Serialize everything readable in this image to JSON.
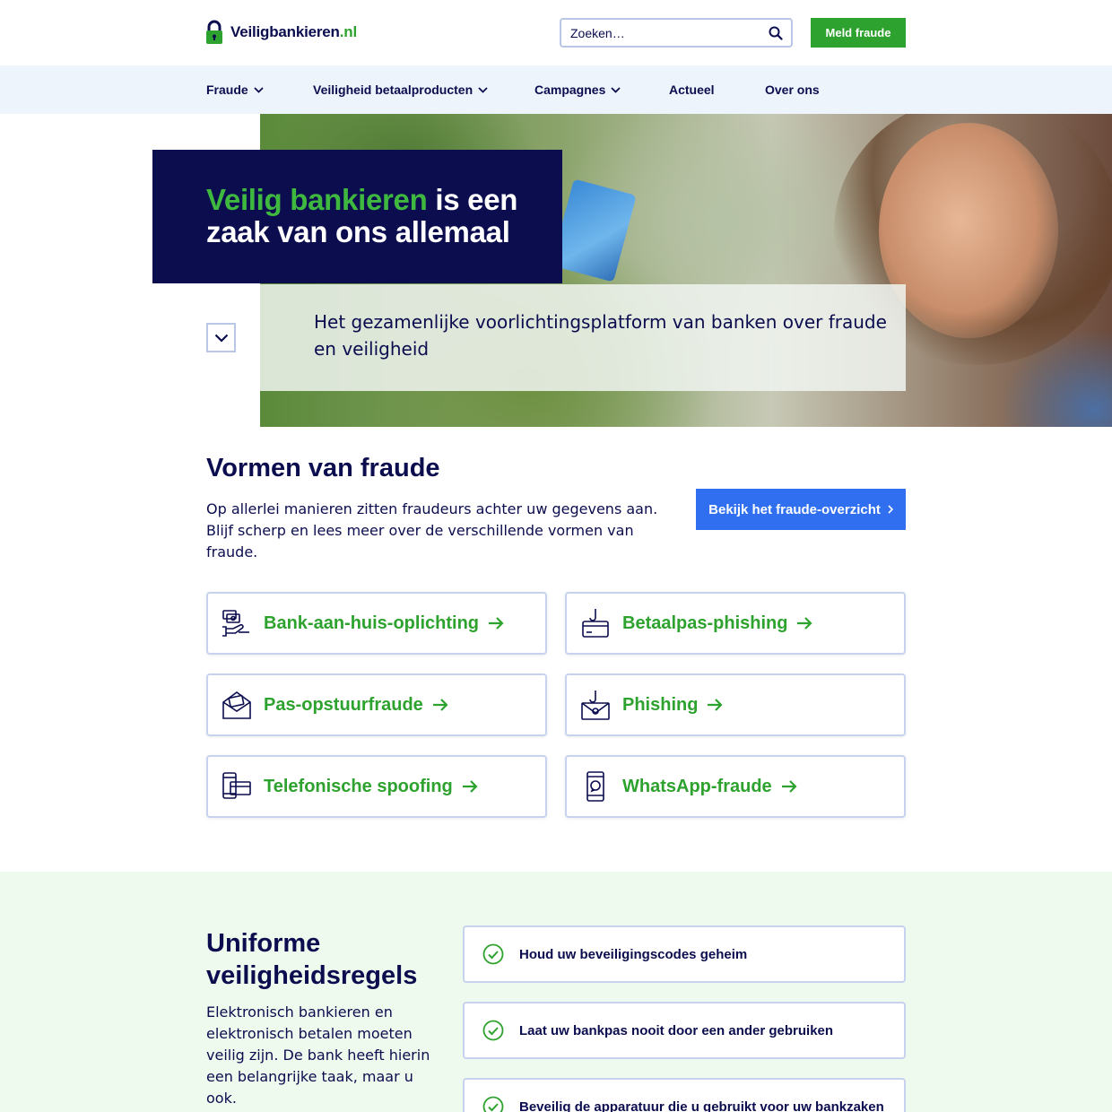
{
  "brand": {
    "name": "Veiligbankieren",
    "tld": ".nl",
    "accent_color": "#2ea22e",
    "navy": "#0b0d4f",
    "blue": "#2f6ff0"
  },
  "header": {
    "search_placeholder": "Zoeken…",
    "report_label": "Meld fraude"
  },
  "nav": {
    "items": [
      {
        "label": "Fraude",
        "has_dropdown": true
      },
      {
        "label": "Veiligheid betaalproducten",
        "has_dropdown": true
      },
      {
        "label": "Campagnes",
        "has_dropdown": true
      },
      {
        "label": "Actueel",
        "has_dropdown": false
      },
      {
        "label": "Over ons",
        "has_dropdown": false
      }
    ]
  },
  "hero": {
    "title_accent": "Veilig bankieren",
    "title_rest": " is een zaak van ons allemaal",
    "subtitle": "Het gezamenlijke voorlichtingsplatform van banken over fraude en veiligheid"
  },
  "fraud": {
    "title": "Vormen van fraude",
    "text": "Op allerlei manieren zitten fraudeurs achter uw gegevens aan. Blijf scherp en lees meer over de verschillende vormen van fraude.",
    "overview_button": "Bekijk het fraude-overzicht",
    "cards": [
      {
        "label": "Bank-aan-huis-oplichting",
        "icon": "hand-money-icon"
      },
      {
        "label": "Betaalpas-phishing",
        "icon": "card-hook-icon"
      },
      {
        "label": "Pas-opstuurfraude",
        "icon": "envelope-card-icon"
      },
      {
        "label": "Phishing",
        "icon": "envelope-hook-icon"
      },
      {
        "label": "Telefonische spoofing",
        "icon": "phone-card-icon"
      },
      {
        "label": "WhatsApp-fraude",
        "icon": "smartphone-icon"
      }
    ]
  },
  "rules": {
    "title": "Uniforme veiligheidsregels",
    "text": "Elektronisch bankieren en elektronisch betalen moeten veilig zijn. De bank heeft hierin een belangrijke taak, maar u ook.",
    "items": [
      {
        "label": "Houd uw beveiligingscodes geheim"
      },
      {
        "label": "Laat uw bankpas nooit door een ander gebruiken"
      },
      {
        "label": "Beveilig de apparatuur die u gebruikt voor uw bankzaken"
      }
    ]
  }
}
